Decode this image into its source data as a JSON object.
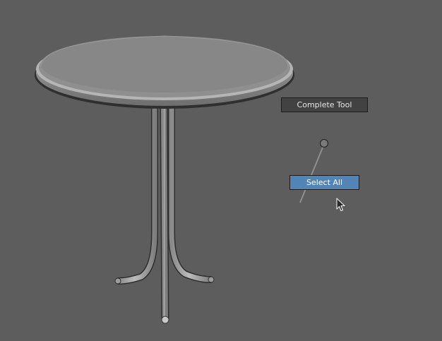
{
  "viewport": {
    "background_color": "#5d5d5d",
    "object": "round-pedestal-table"
  },
  "marking_menu": {
    "items": [
      {
        "id": "complete_tool",
        "label": "Complete Tool",
        "highlighted": false
      },
      {
        "id": "select_all",
        "label": "Select All",
        "highlighted": true
      }
    ],
    "highlight_color": "#5285b5"
  },
  "cursor": {
    "icon": "arrow-cursor-icon"
  }
}
